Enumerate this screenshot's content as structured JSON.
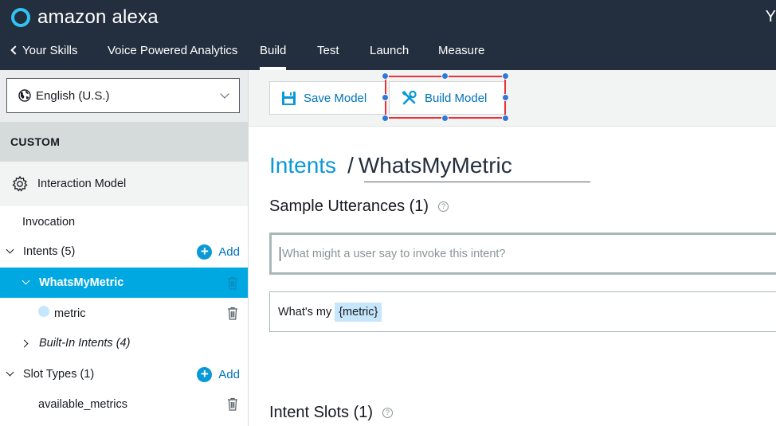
{
  "header": {
    "brand": "amazon alexa",
    "right_text": "Y"
  },
  "nav": {
    "back_label": "Your Skills",
    "tabs": [
      "Voice Powered Analytics",
      "Build",
      "Test",
      "Launch",
      "Measure"
    ],
    "active_tab": "Build"
  },
  "sidebar": {
    "language": "English (U.S.)",
    "section_header": "CUSTOM",
    "interaction_model": "Interaction Model",
    "invocation": "Invocation",
    "intents_label": "Intents (5)",
    "add_label": "Add",
    "selected_intent": "WhatsMyMetric",
    "slot_name": "metric",
    "builtin_intents": "Built-In Intents (4)",
    "slot_types_label": "Slot Types (1)",
    "slot_type_item": "available_metrics"
  },
  "toolbar": {
    "save_label": "Save Model",
    "build_label": "Build Model"
  },
  "main": {
    "breadcrumb_link": "Intents",
    "breadcrumb_sep": "/",
    "intent_name": "WhatsMyMetric",
    "sample_utterances_title": "Sample Utterances (1)",
    "utterance_placeholder": "What might a user say to invoke this intent?",
    "utterance_prefix": "What's my",
    "utterance_slot": "{metric}",
    "intent_slots_title": "Intent Slots (1)",
    "help_glyph": "?"
  },
  "colors": {
    "topbar": "#232f3e",
    "accent": "#00a8e1",
    "link": "#0073bb",
    "selection": "#e8333a"
  }
}
